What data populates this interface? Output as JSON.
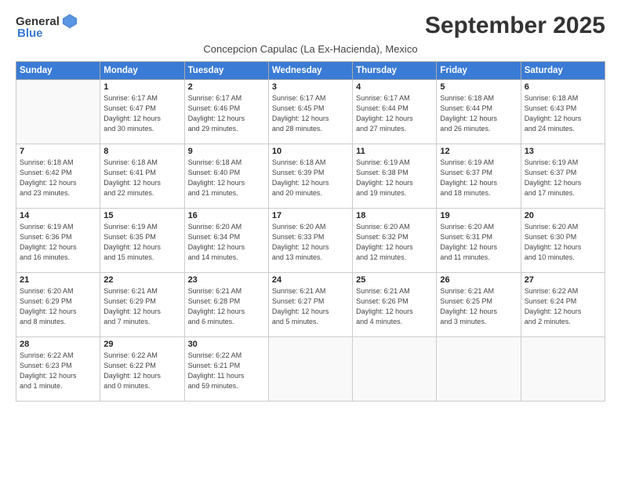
{
  "header": {
    "logo_general": "General",
    "logo_blue": "Blue",
    "month_title": "September 2025",
    "subtitle": "Concepcion Capulac (La Ex-Hacienda), Mexico"
  },
  "weekdays": [
    "Sunday",
    "Monday",
    "Tuesday",
    "Wednesday",
    "Thursday",
    "Friday",
    "Saturday"
  ],
  "weeks": [
    [
      {
        "day": "",
        "sunrise": "",
        "sunset": "",
        "daylight": ""
      },
      {
        "day": "1",
        "sunrise": "Sunrise: 6:17 AM",
        "sunset": "Sunset: 6:47 PM",
        "daylight": "Daylight: 12 hours and 30 minutes."
      },
      {
        "day": "2",
        "sunrise": "Sunrise: 6:17 AM",
        "sunset": "Sunset: 6:46 PM",
        "daylight": "Daylight: 12 hours and 29 minutes."
      },
      {
        "day": "3",
        "sunrise": "Sunrise: 6:17 AM",
        "sunset": "Sunset: 6:45 PM",
        "daylight": "Daylight: 12 hours and 28 minutes."
      },
      {
        "day": "4",
        "sunrise": "Sunrise: 6:17 AM",
        "sunset": "Sunset: 6:44 PM",
        "daylight": "Daylight: 12 hours and 27 minutes."
      },
      {
        "day": "5",
        "sunrise": "Sunrise: 6:18 AM",
        "sunset": "Sunset: 6:44 PM",
        "daylight": "Daylight: 12 hours and 26 minutes."
      },
      {
        "day": "6",
        "sunrise": "Sunrise: 6:18 AM",
        "sunset": "Sunset: 6:43 PM",
        "daylight": "Daylight: 12 hours and 24 minutes."
      }
    ],
    [
      {
        "day": "7",
        "sunrise": "Sunrise: 6:18 AM",
        "sunset": "Sunset: 6:42 PM",
        "daylight": "Daylight: 12 hours and 23 minutes."
      },
      {
        "day": "8",
        "sunrise": "Sunrise: 6:18 AM",
        "sunset": "Sunset: 6:41 PM",
        "daylight": "Daylight: 12 hours and 22 minutes."
      },
      {
        "day": "9",
        "sunrise": "Sunrise: 6:18 AM",
        "sunset": "Sunset: 6:40 PM",
        "daylight": "Daylight: 12 hours and 21 minutes."
      },
      {
        "day": "10",
        "sunrise": "Sunrise: 6:18 AM",
        "sunset": "Sunset: 6:39 PM",
        "daylight": "Daylight: 12 hours and 20 minutes."
      },
      {
        "day": "11",
        "sunrise": "Sunrise: 6:19 AM",
        "sunset": "Sunset: 6:38 PM",
        "daylight": "Daylight: 12 hours and 19 minutes."
      },
      {
        "day": "12",
        "sunrise": "Sunrise: 6:19 AM",
        "sunset": "Sunset: 6:37 PM",
        "daylight": "Daylight: 12 hours and 18 minutes."
      },
      {
        "day": "13",
        "sunrise": "Sunrise: 6:19 AM",
        "sunset": "Sunset: 6:37 PM",
        "daylight": "Daylight: 12 hours and 17 minutes."
      }
    ],
    [
      {
        "day": "14",
        "sunrise": "Sunrise: 6:19 AM",
        "sunset": "Sunset: 6:36 PM",
        "daylight": "Daylight: 12 hours and 16 minutes."
      },
      {
        "day": "15",
        "sunrise": "Sunrise: 6:19 AM",
        "sunset": "Sunset: 6:35 PM",
        "daylight": "Daylight: 12 hours and 15 minutes."
      },
      {
        "day": "16",
        "sunrise": "Sunrise: 6:20 AM",
        "sunset": "Sunset: 6:34 PM",
        "daylight": "Daylight: 12 hours and 14 minutes."
      },
      {
        "day": "17",
        "sunrise": "Sunrise: 6:20 AM",
        "sunset": "Sunset: 6:33 PM",
        "daylight": "Daylight: 12 hours and 13 minutes."
      },
      {
        "day": "18",
        "sunrise": "Sunrise: 6:20 AM",
        "sunset": "Sunset: 6:32 PM",
        "daylight": "Daylight: 12 hours and 12 minutes."
      },
      {
        "day": "19",
        "sunrise": "Sunrise: 6:20 AM",
        "sunset": "Sunset: 6:31 PM",
        "daylight": "Daylight: 12 hours and 11 minutes."
      },
      {
        "day": "20",
        "sunrise": "Sunrise: 6:20 AM",
        "sunset": "Sunset: 6:30 PM",
        "daylight": "Daylight: 12 hours and 10 minutes."
      }
    ],
    [
      {
        "day": "21",
        "sunrise": "Sunrise: 6:20 AM",
        "sunset": "Sunset: 6:29 PM",
        "daylight": "Daylight: 12 hours and 8 minutes."
      },
      {
        "day": "22",
        "sunrise": "Sunrise: 6:21 AM",
        "sunset": "Sunset: 6:29 PM",
        "daylight": "Daylight: 12 hours and 7 minutes."
      },
      {
        "day": "23",
        "sunrise": "Sunrise: 6:21 AM",
        "sunset": "Sunset: 6:28 PM",
        "daylight": "Daylight: 12 hours and 6 minutes."
      },
      {
        "day": "24",
        "sunrise": "Sunrise: 6:21 AM",
        "sunset": "Sunset: 6:27 PM",
        "daylight": "Daylight: 12 hours and 5 minutes."
      },
      {
        "day": "25",
        "sunrise": "Sunrise: 6:21 AM",
        "sunset": "Sunset: 6:26 PM",
        "daylight": "Daylight: 12 hours and 4 minutes."
      },
      {
        "day": "26",
        "sunrise": "Sunrise: 6:21 AM",
        "sunset": "Sunset: 6:25 PM",
        "daylight": "Daylight: 12 hours and 3 minutes."
      },
      {
        "day": "27",
        "sunrise": "Sunrise: 6:22 AM",
        "sunset": "Sunset: 6:24 PM",
        "daylight": "Daylight: 12 hours and 2 minutes."
      }
    ],
    [
      {
        "day": "28",
        "sunrise": "Sunrise: 6:22 AM",
        "sunset": "Sunset: 6:23 PM",
        "daylight": "Daylight: 12 hours and 1 minute."
      },
      {
        "day": "29",
        "sunrise": "Sunrise: 6:22 AM",
        "sunset": "Sunset: 6:22 PM",
        "daylight": "Daylight: 12 hours and 0 minutes."
      },
      {
        "day": "30",
        "sunrise": "Sunrise: 6:22 AM",
        "sunset": "Sunset: 6:21 PM",
        "daylight": "Daylight: 11 hours and 59 minutes."
      },
      {
        "day": "",
        "sunrise": "",
        "sunset": "",
        "daylight": ""
      },
      {
        "day": "",
        "sunrise": "",
        "sunset": "",
        "daylight": ""
      },
      {
        "day": "",
        "sunrise": "",
        "sunset": "",
        "daylight": ""
      },
      {
        "day": "",
        "sunrise": "",
        "sunset": "",
        "daylight": ""
      }
    ]
  ]
}
